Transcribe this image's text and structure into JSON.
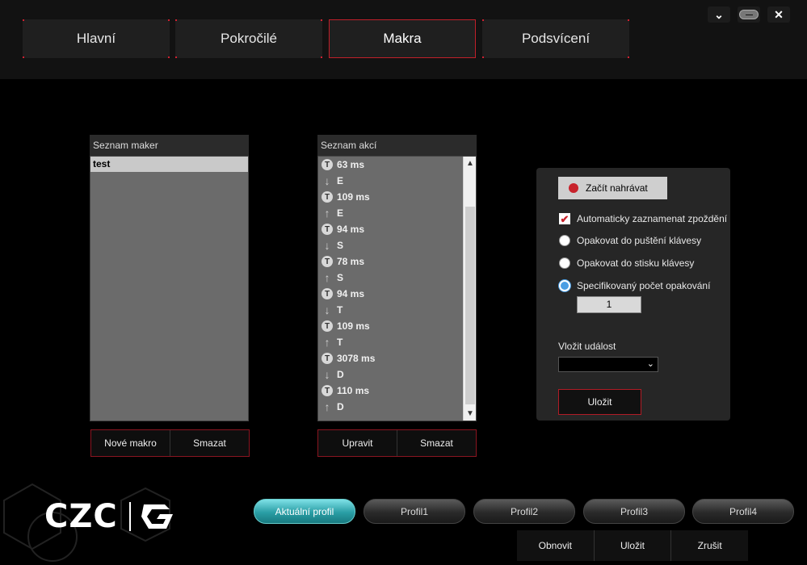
{
  "tabs": [
    {
      "label": "Hlavní"
    },
    {
      "label": "Pokročilé"
    },
    {
      "label": "Makra",
      "active": true
    },
    {
      "label": "Podsvícení"
    }
  ],
  "window": {
    "chevron": "chevron-down-icon",
    "minimize": "minimize-icon",
    "close": "close-icon"
  },
  "macro_list": {
    "title": "Seznam maker",
    "items": [
      "test"
    ],
    "buttons": {
      "new": "Nové makro",
      "delete": "Smazat"
    }
  },
  "action_list": {
    "title": "Seznam akcí",
    "items": [
      {
        "type": "T",
        "text": "63 ms"
      },
      {
        "type": "down",
        "text": "E"
      },
      {
        "type": "T",
        "text": "109 ms"
      },
      {
        "type": "up",
        "text": "E"
      },
      {
        "type": "T",
        "text": "94 ms"
      },
      {
        "type": "down",
        "text": "S"
      },
      {
        "type": "T",
        "text": "78 ms"
      },
      {
        "type": "up",
        "text": "S"
      },
      {
        "type": "T",
        "text": "94 ms"
      },
      {
        "type": "down",
        "text": "T"
      },
      {
        "type": "T",
        "text": "109 ms"
      },
      {
        "type": "up",
        "text": "T"
      },
      {
        "type": "T",
        "text": "3078 ms"
      },
      {
        "type": "down",
        "text": "D"
      },
      {
        "type": "T",
        "text": "110 ms"
      },
      {
        "type": "up",
        "text": "D"
      }
    ],
    "buttons": {
      "edit": "Upravit",
      "delete": "Smazat"
    }
  },
  "settings": {
    "record_label": "Začít nahrávat",
    "auto_delay": {
      "label": "Automaticky zaznamenat zpoždění",
      "checked": true
    },
    "repeat_options": [
      {
        "label": "Opakovat do puštění klávesy",
        "selected": false
      },
      {
        "label": "Opakovat do stisku klávesy",
        "selected": false
      },
      {
        "label": "Specifikovaný počet opakování",
        "selected": true
      }
    ],
    "repeat_count": "1",
    "insert_event_label": "Vložit událost",
    "insert_event_value": "",
    "save_label": "Uložit"
  },
  "logo": {
    "text": "CZC",
    "icon": "czc-gaming-logo"
  },
  "profiles": [
    {
      "label": "Aktuální profil",
      "active": true
    },
    {
      "label": "Profil1"
    },
    {
      "label": "Profil2"
    },
    {
      "label": "Profil3"
    },
    {
      "label": "Profil4"
    }
  ],
  "footer": {
    "reset": "Obnovit",
    "save": "Uložit",
    "cancel": "Zrušit"
  },
  "colors": {
    "accent_red": "#c8232c",
    "active_profile": "#2a9ea5",
    "radio_selected": "#4a9ee4"
  }
}
